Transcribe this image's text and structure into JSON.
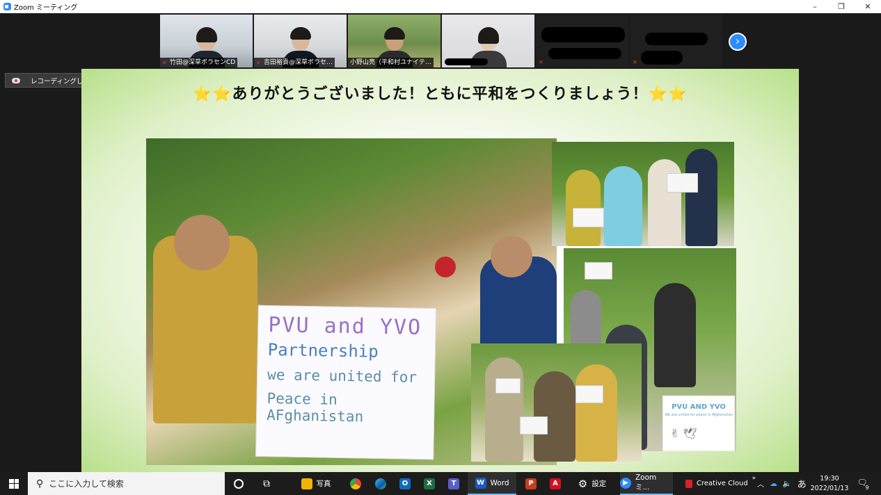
{
  "window": {
    "title": "Zoom ミーティング",
    "minimize": "–",
    "restore": "❐",
    "close": "✕"
  },
  "participants": [
    {
      "name": "竹田@深草ボラセンCD",
      "muted": true
    },
    {
      "name": "吉田裕貴@深草ボラセ…",
      "muted": true
    },
    {
      "name": "小野山亮（平和村ユナイテ…",
      "muted": false
    },
    {
      "name": "",
      "muted": false
    },
    {
      "name": "",
      "muted": true
    },
    {
      "name": "",
      "muted": true
    }
  ],
  "next_page_icon": "chevron-right-icon",
  "recording": {
    "label": "レコーディングしています..."
  },
  "slide": {
    "title": "⭐⭐ありがとうございました！ともに平和をつくりましょう！⭐⭐",
    "sign": {
      "line1": "PVU and YVO",
      "line2": "Partnership",
      "line3": "we are united for",
      "line4": "Peace in AFghanistan"
    },
    "card": {
      "title": "PVU AND YVO",
      "subtitle": "We are united for peace in Afghanistan",
      "symbols": "✌       🕊"
    }
  },
  "taskbar": {
    "search_placeholder": "ここに入力して検索",
    "apps": [
      {
        "name": "cortana",
        "label": ""
      },
      {
        "name": "task-view",
        "label": ""
      },
      {
        "name": "photos",
        "label": "写真"
      },
      {
        "name": "chrome",
        "label": ""
      },
      {
        "name": "edge",
        "label": ""
      },
      {
        "name": "outlook",
        "label": ""
      },
      {
        "name": "excel",
        "label": ""
      },
      {
        "name": "teams",
        "label": ""
      },
      {
        "name": "word",
        "label": "Word"
      },
      {
        "name": "powerpoint",
        "label": ""
      },
      {
        "name": "acrobat",
        "label": ""
      },
      {
        "name": "settings",
        "label": "設定"
      },
      {
        "name": "zoom",
        "label": "Zoom ミ..."
      }
    ],
    "creative_cloud": "Creative Cloud",
    "ime": "あ",
    "time": "19:30",
    "date": "2022/01/13",
    "notification_count": "9"
  },
  "colors": {
    "zoom_blue": "#2d8cff",
    "slide_green": "#b8e08a",
    "taskbar": "#1c1c1c"
  }
}
